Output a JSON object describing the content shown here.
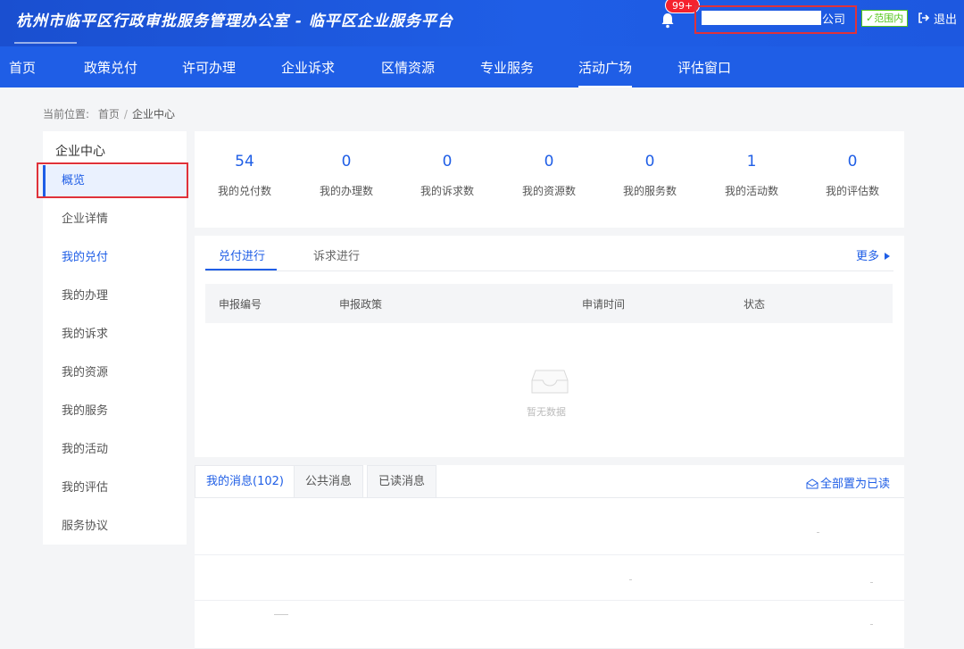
{
  "header": {
    "site_title": "杭州市临平区行政审批服务管理办公室 - 临平区企业服务平台",
    "notification_count": "99+",
    "company_suffix": "公司",
    "scope_label": "✓范围内",
    "logout_label": "退出"
  },
  "nav": {
    "items": [
      {
        "label": "首页"
      },
      {
        "label": "政策兑付"
      },
      {
        "label": "许可办理"
      },
      {
        "label": "企业诉求"
      },
      {
        "label": "区情资源"
      },
      {
        "label": "专业服务"
      },
      {
        "label": "活动广场",
        "active": true
      },
      {
        "label": "评估窗口"
      }
    ]
  },
  "breadcrumb": {
    "prefix": "当前位置:",
    "home": "首页",
    "separator": "/",
    "current": "企业中心"
  },
  "sidebar": {
    "title": "企业中心",
    "items": [
      {
        "label": "概览",
        "active": true
      },
      {
        "label": "企业详情"
      },
      {
        "label": "我的兑付"
      },
      {
        "label": "我的办理"
      },
      {
        "label": "我的诉求"
      },
      {
        "label": "我的资源"
      },
      {
        "label": "我的服务"
      },
      {
        "label": "我的活动"
      },
      {
        "label": "我的评估"
      },
      {
        "label": "服务协议"
      }
    ]
  },
  "stats": [
    {
      "value": "54",
      "label": "我的兑付数"
    },
    {
      "value": "0",
      "label": "我的办理数"
    },
    {
      "value": "0",
      "label": "我的诉求数"
    },
    {
      "value": "0",
      "label": "我的资源数"
    },
    {
      "value": "0",
      "label": "我的服务数"
    },
    {
      "value": "1",
      "label": "我的活动数"
    },
    {
      "value": "0",
      "label": "我的评估数"
    }
  ],
  "records": {
    "tabs": [
      {
        "label": "兑付进行"
      },
      {
        "label": "诉求进行"
      }
    ],
    "more_label": "更多",
    "columns": [
      "申报编号",
      "申报政策",
      "申请时间",
      "状态"
    ],
    "empty_text": "暂无数据"
  },
  "messages": {
    "tabs": [
      {
        "label": "我的消息(102)"
      },
      {
        "label": "公共消息"
      },
      {
        "label": "已读消息"
      }
    ],
    "mark_all_label": "全部置为已读"
  },
  "colors": {
    "primary": "#1f5ee6",
    "header_dark": "#1a4fd0",
    "highlight_red": "#e0323a",
    "badge_red": "#f5222d",
    "scope_green": "#52c41a"
  }
}
